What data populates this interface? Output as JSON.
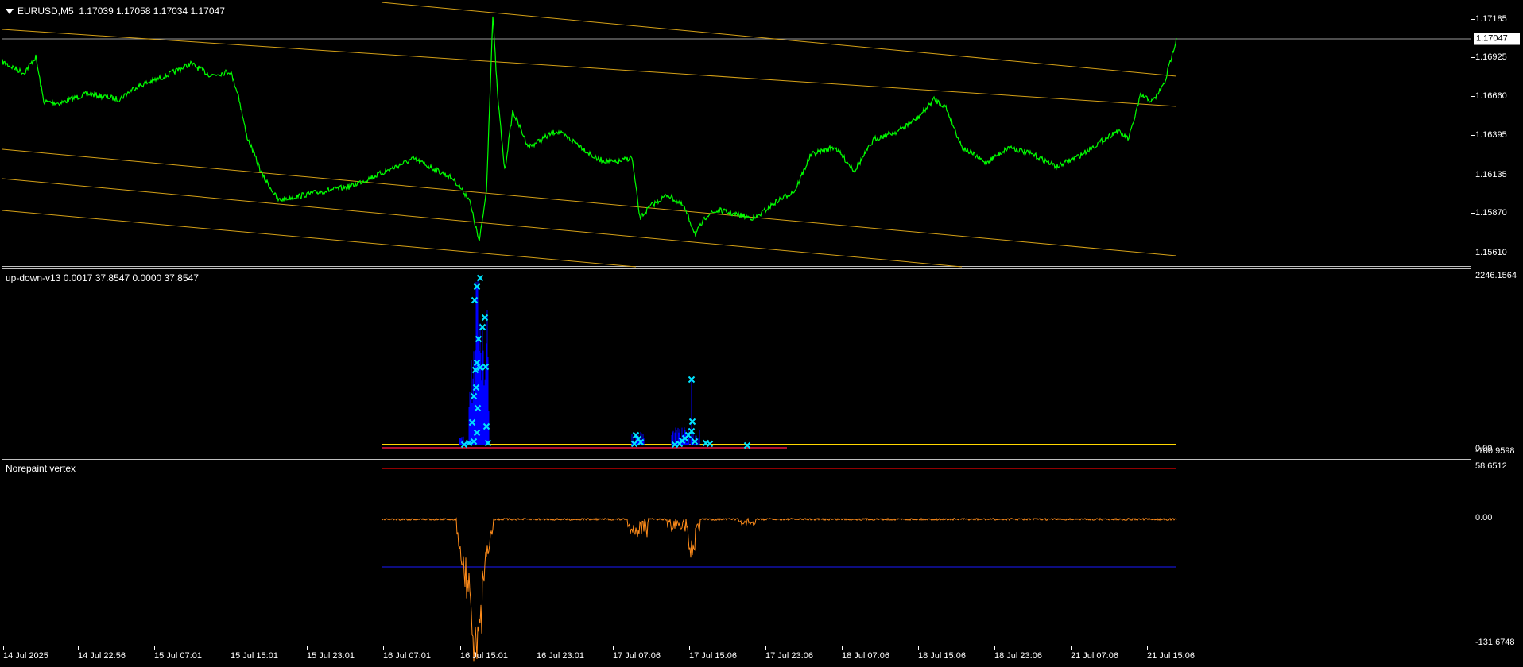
{
  "symbol_title": "EURUSD,M5",
  "ohlc": "1.17039 1.17058 1.17034 1.17047",
  "current_price": "1.17047",
  "main_axis": [
    "1.17185",
    "1.16925",
    "1.16660",
    "1.16395",
    "1.16135",
    "1.15870",
    "1.15610"
  ],
  "indicator1": {
    "title": "up-down-v13 0.0017 37.8547 0.0000 37.8547",
    "axis_top": "2246.1564",
    "axis_zero": "0.00",
    "axis_bottom": "-100.9598"
  },
  "indicator2": {
    "title": "Norepaint vertex",
    "axis_top": "58.6512",
    "axis_zero": "0.00",
    "axis_bottom": "-131.6748"
  },
  "time_axis": [
    "14 Jul 2025",
    "14 Jul 22:56",
    "15 Jul 07:01",
    "15 Jul 15:01",
    "15 Jul 23:01",
    "16 Jul 07:01",
    "16 Jul 15:01",
    "16 Jul 23:01",
    "17 Jul 07:06",
    "17 Jul 15:06",
    "17 Jul 23:06",
    "18 Jul 07:06",
    "18 Jul 15:06",
    "18 Jul 23:06",
    "21 Jul 07:06",
    "21 Jul 15:06"
  ],
  "colors": {
    "price_line": "#00ff00",
    "channel": "#d4a017",
    "histogram": "#0000ff",
    "markers": "#00e5ff",
    "oscillator": "#ff8c1a",
    "upper_level": "#c00000",
    "lower_level": "#1a1aff"
  }
}
